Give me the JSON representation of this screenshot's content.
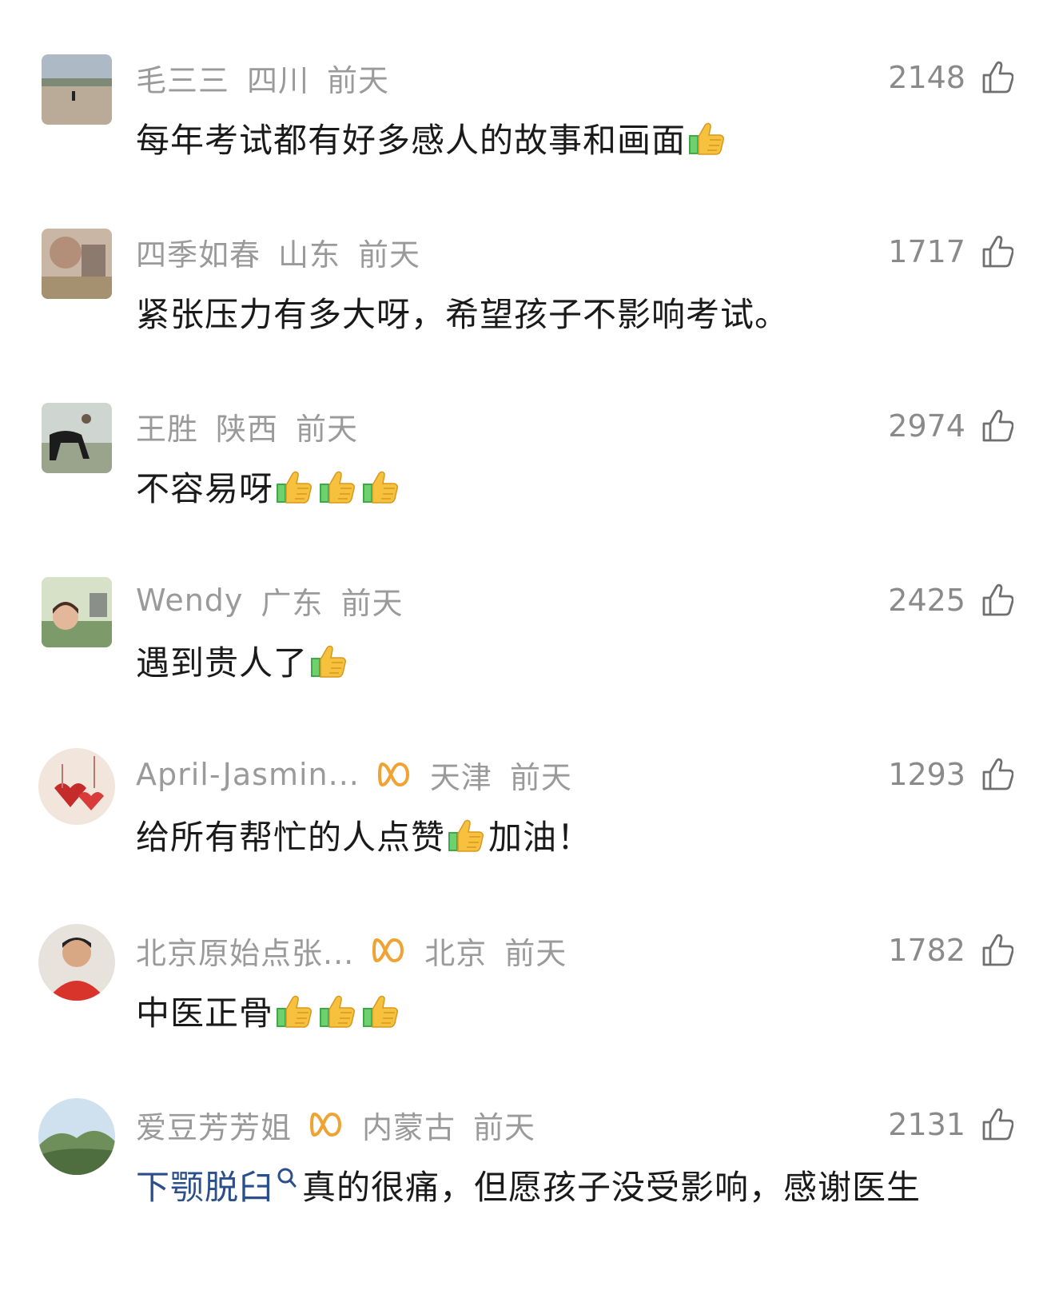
{
  "comments": [
    {
      "user": "毛三三",
      "region": "四川",
      "time": "前天",
      "likes": "2148",
      "text_parts": [
        "每年考试都有好多感人的故事和画面"
      ],
      "emojis_after": [
        1
      ],
      "vip": false
    },
    {
      "user": "四季如春",
      "region": "山东",
      "time": "前天",
      "likes": "1717",
      "text_parts": [
        "紧张压力有多大呀，希望孩子不影响考试。"
      ],
      "vip": false
    },
    {
      "user": "王胜",
      "region": "陕西",
      "time": "前天",
      "likes": "2974",
      "text_parts": [
        "不容易呀"
      ],
      "vip": false
    },
    {
      "user": "Wendy",
      "region": "广东",
      "time": "前天",
      "likes": "2425",
      "text_parts": [
        "遇到贵人了"
      ],
      "vip": false
    },
    {
      "user": "April-Jasmin...",
      "region": "天津",
      "time": "前天",
      "likes": "1293",
      "text_parts": [
        "给所有帮忙的人点赞",
        "加油！"
      ],
      "vip": true
    },
    {
      "user": "北京原始点张...",
      "region": "北京",
      "time": "前天",
      "likes": "1782",
      "text_parts": [
        "中医正骨"
      ],
      "vip": true
    },
    {
      "user": "爱豆芳芳姐",
      "region": "内蒙古",
      "time": "前天",
      "likes": "2131",
      "text_parts": [
        "下颚脱臼",
        "真的很痛，但愿孩子没受影响，感谢医生"
      ],
      "vip": true
    }
  ],
  "icons": {
    "like": "thumbs-up-outline-icon",
    "emoji": "thumbs-up-emoji-icon",
    "vip": "vip-badge-icon",
    "search": "search-icon"
  },
  "colors": {
    "meta": "#9a9a9a",
    "body": "#1a1a1a",
    "link": "#2a4f8c",
    "vip": "#f0a233"
  }
}
